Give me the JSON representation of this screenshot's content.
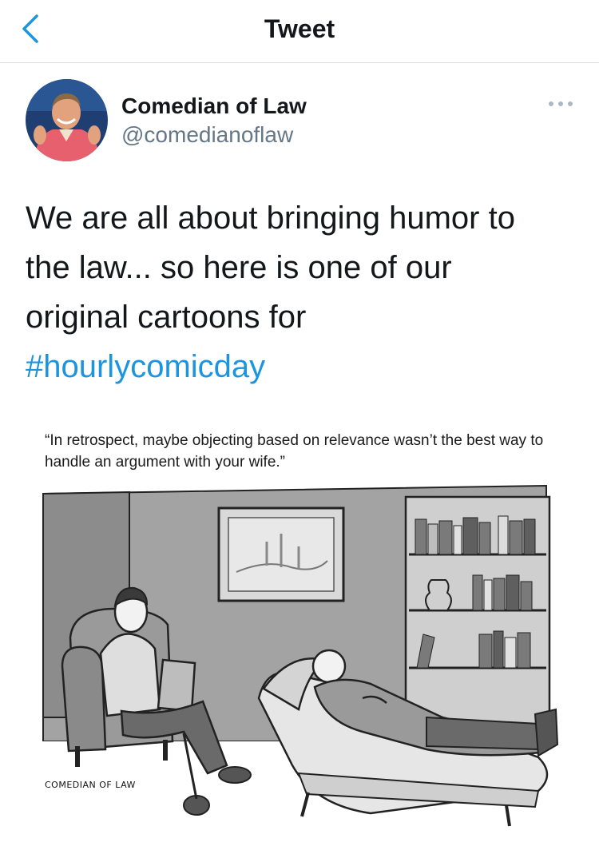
{
  "header": {
    "title": "Tweet",
    "back_icon": "chevron-left-icon"
  },
  "author": {
    "display_name": "Comedian of Law",
    "handle": "@comedianoflaw",
    "avatar_icon": "avatar"
  },
  "tweet": {
    "text_line_1": "We are all about bringing humor to",
    "text_line_2": "the law... so here is one of our",
    "text_line_3": "original cartoons for",
    "hashtag": "#hourlycomicday",
    "more_icon": "more-horizontal-icon"
  },
  "media": {
    "caption": "“In retrospect, maybe objecting based on relevance wasn’t the best way to handle an argument with your wife.”",
    "signature": "COMEDIAN OF LAW"
  },
  "colors": {
    "accent": "#1b95e0",
    "text": "#14171a",
    "secondary_text": "#657786",
    "divider": "#d9dde1"
  }
}
